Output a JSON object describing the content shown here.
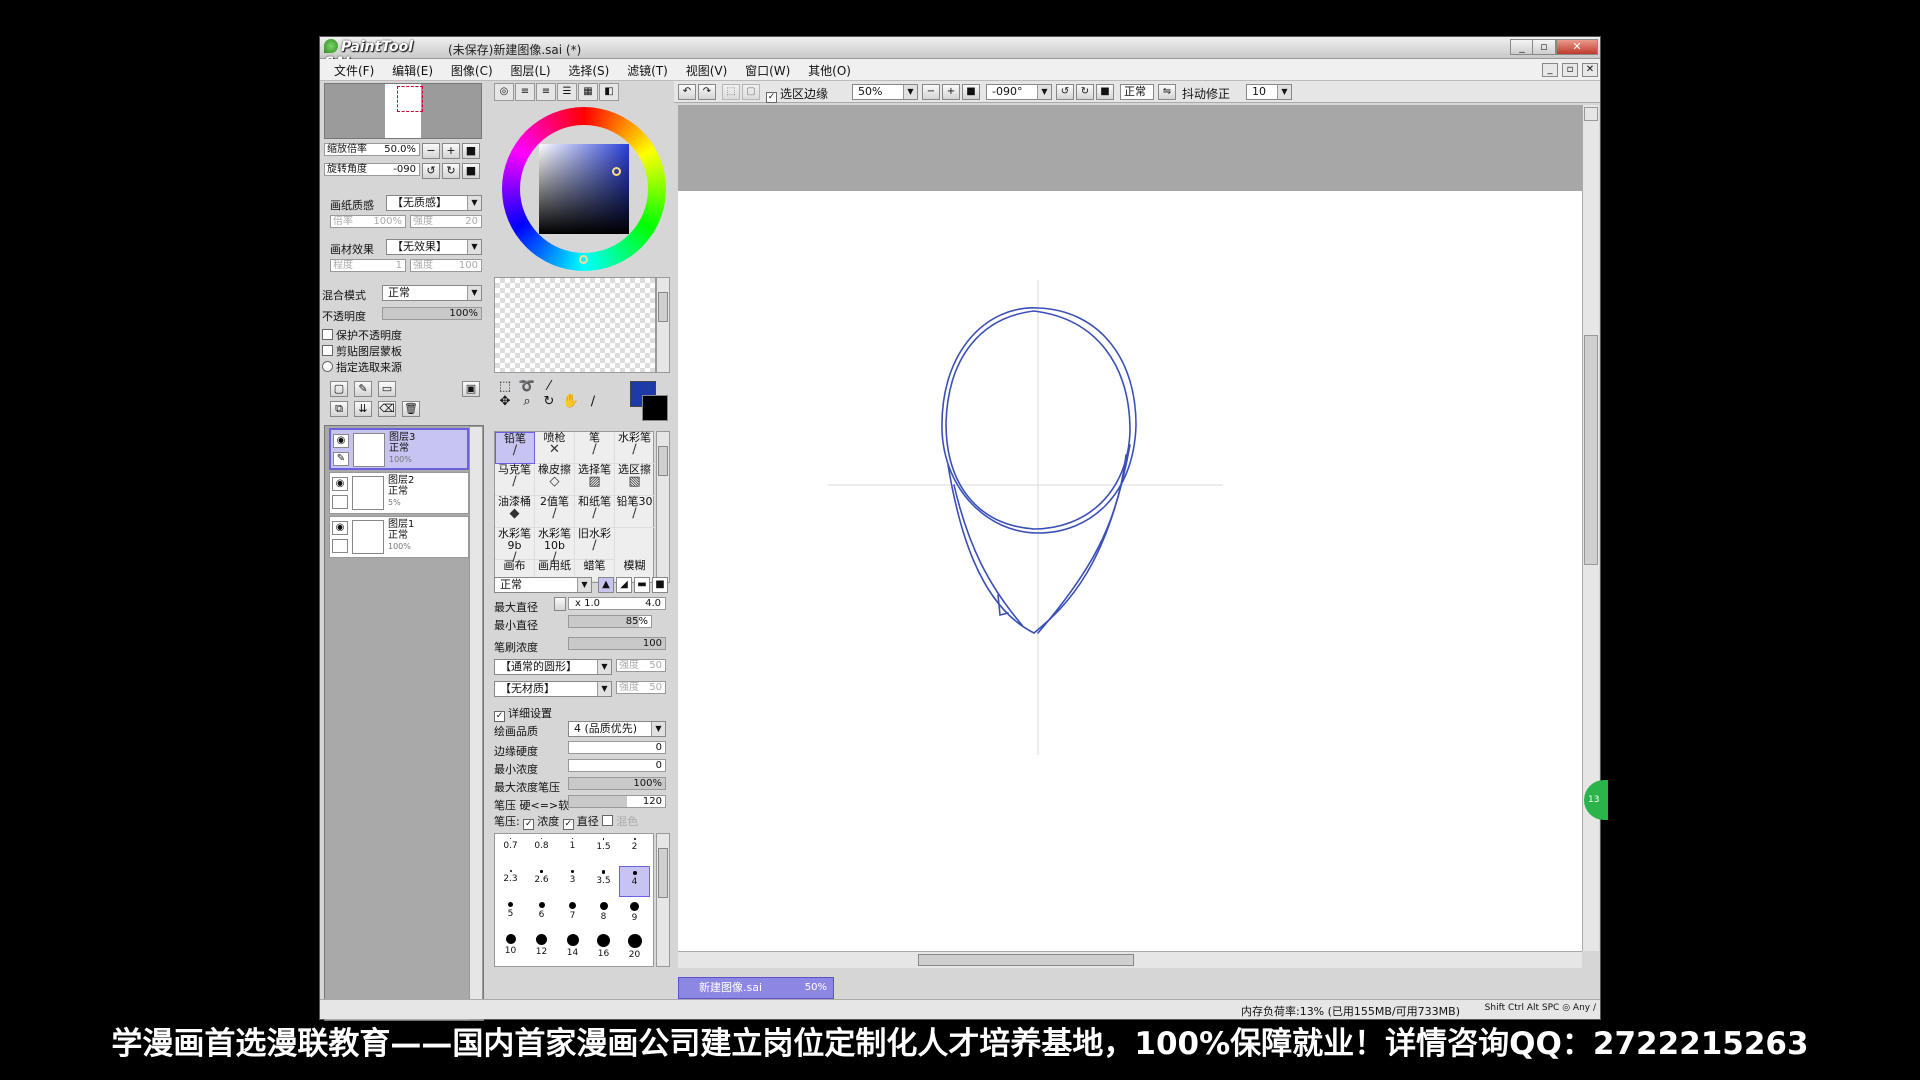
{
  "window": {
    "app_logo": "PaintTool SAI",
    "title": "(未保存)新建图像.sai (*)",
    "controls": {
      "minimize": "_",
      "restore": "▫",
      "close": "✕"
    }
  },
  "menu": [
    "文件(F)",
    "编辑(E)",
    "图像(C)",
    "图层(L)",
    "选择(S)",
    "滤镜(T)",
    "视图(V)",
    "窗口(W)",
    "其他(O)"
  ],
  "navigator": {
    "zoom_label": "缩放倍率",
    "zoom_value": "50.0%",
    "rotate_label": "旋转角度",
    "rotate_value": "-090"
  },
  "paper": {
    "texture_label": "画纸质感",
    "texture_value": "【无质感】",
    "texture_scale": "倍率",
    "texture_scale_val": "100%",
    "texture_strength": "强度",
    "texture_strength_val": "20",
    "effect_label": "画材效果",
    "effect_value": "【无效果】",
    "effect_degree": "程度",
    "effect_degree_val": "1",
    "effect_strength": "强度",
    "effect_strength_val": "100"
  },
  "layer_props": {
    "blend_label": "混合模式",
    "blend_value": "正常",
    "opacity_label": "不透明度",
    "opacity_value": "100%",
    "opacity_fraction": 1.0,
    "preserve_opacity": "保护不透明度",
    "clipping": "剪贴图层蒙板",
    "selection_source": "指定选取来源"
  },
  "layers": [
    {
      "name": "图层3",
      "mode": "正常",
      "opacity": "100%",
      "selected": true
    },
    {
      "name": "图层2",
      "mode": "正常",
      "opacity": "5%",
      "selected": false
    },
    {
      "name": "图层1",
      "mode": "正常",
      "opacity": "100%",
      "selected": false
    }
  ],
  "brushes": [
    [
      "铅笔",
      "喷枪",
      "笔",
      "水彩笔"
    ],
    [
      "马克笔",
      "橡皮擦",
      "选择笔",
      "选区擦"
    ],
    [
      "油漆桶",
      "2值笔",
      "和纸笔",
      "铅笔30"
    ],
    [
      "水彩笔9b",
      "水彩笔10b",
      "旧水彩",
      ""
    ],
    [
      "画布",
      "画用纸",
      "蜡笔",
      "模糊"
    ]
  ],
  "brush_settings": {
    "mode": "正常",
    "max_size_label": "最大直径",
    "max_size_mult": "x 1.0",
    "max_size_value": "4.0",
    "min_size_label": "最小直径",
    "min_size_value": "85%",
    "density_label": "笔刷浓度",
    "density_value": "100",
    "shape": "【通常的圆形】",
    "shape_strength": "强度",
    "shape_strength_val": "50",
    "texture": "【无材质】",
    "texture_strength": "强度",
    "texture_strength_val": "50",
    "detail_label": "详细设置",
    "quality_label": "绘画品质",
    "quality_value": "4 (品质优先)",
    "edge_label": "边缘硬度",
    "edge_value": "0",
    "min_density_label": "最小浓度",
    "min_density_value": "0",
    "max_pressure_label": "最大浓度笔压",
    "max_pressure_value": "100%",
    "pressure_label": "笔压 硬<=>软",
    "pressure_value": "120",
    "pressure_opts_label": "笔压:",
    "pressure_density": "浓度",
    "pressure_size": "直径",
    "pressure_blend": "混色"
  },
  "sizes": [
    "0.7",
    "0.8",
    "1",
    "1.5",
    "2",
    "2.3",
    "2.6",
    "3",
    "3.5",
    "4",
    "5",
    "6",
    "7",
    "8",
    "9",
    "10",
    "12",
    "14",
    "16",
    "20"
  ],
  "selected_size": "4",
  "canvas_toolbar": {
    "selection_edge": "选区边缘",
    "zoom": "50%",
    "angle": "-090°",
    "mode": "正常",
    "stabilizer_label": "抖动修正",
    "stabilizer_value": "10"
  },
  "doc_tab": {
    "name": "新建图像.sai",
    "zoom": "50%"
  },
  "status": {
    "memory": "内存负荷率:13% (已用155MB/可用733MB)",
    "keys": "Shift Ctrl Alt SPC ◎ Any ∕"
  },
  "colors": {
    "foreground": "#1e3aa8",
    "background": "#000000",
    "sketch": "#3a4fb8"
  },
  "overlay_badge": "13",
  "banner": "学漫画首选漫联教育——国内首家漫画公司建立岗位定制化人才培养基地，100%保障就业！详情咨询QQ：2722215263"
}
